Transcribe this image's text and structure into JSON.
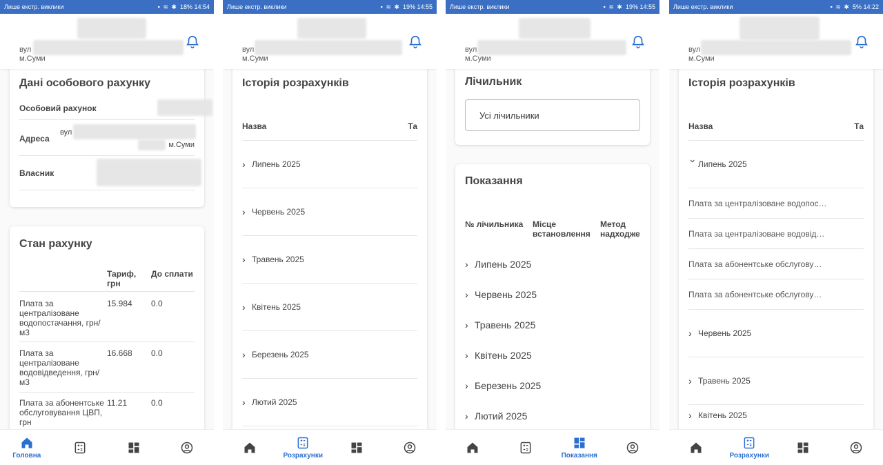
{
  "status_bar": [
    {
      "carrier": "Лише екстр. виклики",
      "battery": "18%",
      "time": "14:54"
    },
    {
      "carrier": "Лише екстр. виклики",
      "battery": "19%",
      "time": "14:55"
    },
    {
      "carrier": "Лише екстр. виклики",
      "battery": "19%",
      "time": "14:55"
    },
    {
      "carrier": "Лише екстр. виклики",
      "battery": "5%",
      "time": "14:22"
    }
  ],
  "header": {
    "street_prefix": "вул",
    "city": "м.Суми"
  },
  "nav": {
    "home": "Головна",
    "payments": "Розрахунки",
    "readings": "Показання"
  },
  "screen1": {
    "account_card": {
      "title": "Дані особового рахунку",
      "rows": [
        {
          "label": "Особовий рахунок"
        },
        {
          "label": "Адреса",
          "street_prefix": "вул",
          "city": "м.Суми"
        },
        {
          "label": "Власник"
        }
      ]
    },
    "status_card": {
      "title": "Стан рахунку",
      "col_tariff": "Тариф, грн",
      "col_due": "До сплати",
      "rows": [
        {
          "name": "Плата за централізоване водопостачання, грн/м3",
          "tariff": "15.984",
          "due": "0.0"
        },
        {
          "name": "Плата за централізоване водовідведення, грн/м3",
          "tariff": "16.668",
          "due": "0.0"
        },
        {
          "name": "Плата за абонентське обслуговування ЦВП, грн",
          "tariff": "11.21",
          "due": "0.0"
        }
      ]
    }
  },
  "screen2": {
    "title": "Історія розрахунків",
    "col_name": "Назва",
    "col_extra": "Та",
    "months": [
      "Липень 2025",
      "Червень 2025",
      "Травень 2025",
      "Квітень 2025",
      "Березень 2025",
      "Лютий 2025"
    ]
  },
  "screen3": {
    "meter_card": {
      "title": "Лічильник",
      "select_value": "Усі лічильники"
    },
    "readings_card": {
      "title": "Показання",
      "col_number": "№ лічильника",
      "col_place": "Місце встановлення",
      "col_method": "Метод надходже",
      "months": [
        "Липень 2025",
        "Червень 2025",
        "Травень 2025",
        "Квітень 2025",
        "Березень 2025",
        "Лютий 2025"
      ]
    }
  },
  "screen4": {
    "title": "Історія розрахунків",
    "col_name": "Назва",
    "col_extra": "Та",
    "expanded_month": "Липень 2025",
    "items": [
      "Плата за централізоване водопос…",
      "Плата за централізоване водовід…",
      "Плата за абонентське обслугову…",
      "Плата за абонентське обслугову…"
    ],
    "months": [
      "Червень 2025",
      "Травень 2025",
      "Квітень 2025"
    ]
  }
}
